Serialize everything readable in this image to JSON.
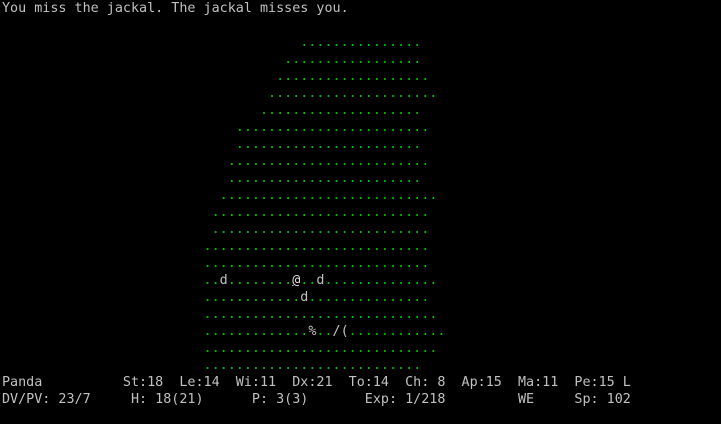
{
  "message": "You miss the jackal. The jackal misses you.",
  "colors": {
    "floor": "#00c000",
    "text": "#c0c0c0",
    "background": "#000000"
  },
  "map": {
    "legend": {
      ".": "floor",
      "@": "player",
      "d": "jackal",
      "%": "food-item",
      "/": "wand-item",
      "(": "tool-item"
    },
    "rows": [
      "                                     ...............",
      "                                   .................",
      "                                  ...................",
      "                                 .....................",
      "                                ....................",
      "                             ........................",
      "                             .......................",
      "                            .........................",
      "                            ........................",
      "                           ...........................",
      "                          ...........................",
      "                          ...........................",
      "                         ............................",
      "                         ............................",
      "                         ..d........@..d..............",
      "                         ............d...............",
      "                         .............................",
      "                         .............%../(............",
      "                         .............................",
      "                         ..........................."
    ]
  },
  "status": {
    "line1": "Panda          St:18  Le:14  Wi:11  Dx:21  To:14  Ch: 8  Ap:15  Ma:11  Pe:15 L",
    "line2": "DV/PV: 23/7     H: 18(21)      P: 3(3)       Exp: 1/218         WE     Sp: 102"
  }
}
